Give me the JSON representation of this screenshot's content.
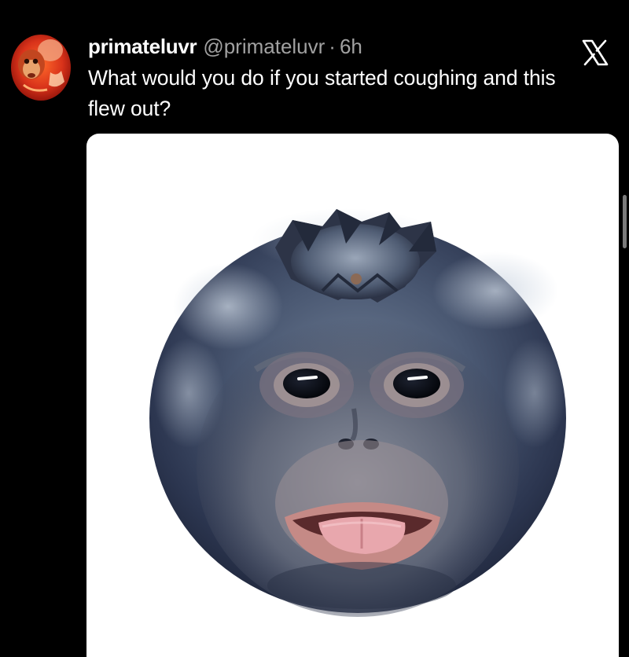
{
  "tweet": {
    "display_name": "primateluvr",
    "handle": "@primateluvr",
    "separator": "·",
    "age": "6h",
    "text": "What would you do if you started coughing and this flew out?"
  },
  "avatar": {
    "icon": "monkey-avatar-icon"
  },
  "header": {
    "logo_icon": "x-logo-icon"
  },
  "media": {
    "subject": "blueberry-with-monkey-face-image"
  },
  "colors": {
    "background": "#000000",
    "text": "#ffffff",
    "secondary_text": "#a1a1a1",
    "media_background": "#ffffff"
  }
}
